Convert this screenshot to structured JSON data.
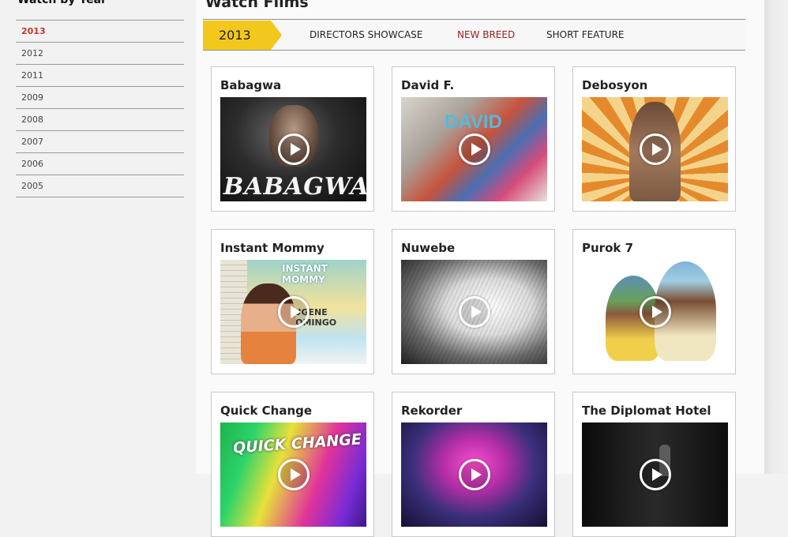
{
  "sidebar": {
    "title": "Watch by Year",
    "years": [
      "2013",
      "2012",
      "2011",
      "2009",
      "2008",
      "2007",
      "2006",
      "2005"
    ],
    "active_year": "2013"
  },
  "main": {
    "title": "Watch Films",
    "year_badge": "2013",
    "tabs": [
      {
        "label": "DIRECTORS SHOWCASE"
      },
      {
        "label": "NEW BREED"
      },
      {
        "label": "SHORT FEATURE"
      }
    ]
  },
  "films": [
    {
      "title": "Babagwa",
      "poster_text": "BABAGWA"
    },
    {
      "title": "David F.",
      "poster_text": "DAVID"
    },
    {
      "title": "Debosyon"
    },
    {
      "title": "Instant Mommy",
      "poster_text": "INSTANT MOMMY",
      "poster_subtext": "EUGENE DOMINGO"
    },
    {
      "title": "Nuwebe"
    },
    {
      "title": "Purok 7"
    },
    {
      "title": "Quick Change",
      "poster_text": "QUICK CHANGE"
    },
    {
      "title": "Rekorder"
    },
    {
      "title": "The Diplomat Hotel"
    }
  ],
  "icons": {
    "play": "play-circle-icon"
  },
  "colors": {
    "accent": "#f3c81c",
    "active_year": "#c0392b",
    "tab_highlight": "#9b1c1c"
  }
}
